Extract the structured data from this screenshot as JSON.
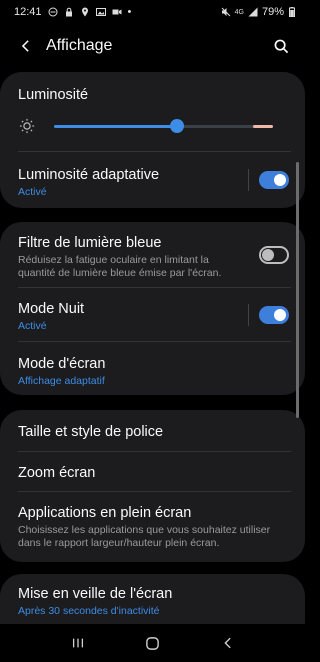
{
  "status": {
    "time": "12:41",
    "battery": "79%",
    "network": "4G"
  },
  "app_bar": {
    "title": "Affichage"
  },
  "brightness": {
    "title": "Luminosité",
    "level": 0.57
  },
  "adaptive": {
    "title": "Luminosité adaptative",
    "subtitle": "Activé",
    "on": true
  },
  "blue_light": {
    "title": "Filtre de lumière bleue",
    "desc": "Réduisez la fatigue oculaire en limitant la quantité de lumière bleue émise par l'écran.",
    "on": false
  },
  "night_mode": {
    "title": "Mode Nuit",
    "subtitle": "Activé",
    "on": true
  },
  "screen_mode": {
    "title": "Mode d'écran",
    "subtitle": "Affichage adaptatif"
  },
  "font": {
    "title": "Taille et style de police"
  },
  "zoom": {
    "title": "Zoom écran"
  },
  "fullscreen": {
    "title": "Applications en plein écran",
    "desc": "Choisissez les applications que vous souhaitez utiliser dans le rapport largeur/hauteur plein écran."
  },
  "timeout": {
    "title": "Mise en veille de l'écran",
    "subtitle": "Après 30 secondes d'inactivité"
  },
  "colors": {
    "accent": "#3d8ce6",
    "card": "#1c1c1e",
    "background": "#000000"
  }
}
